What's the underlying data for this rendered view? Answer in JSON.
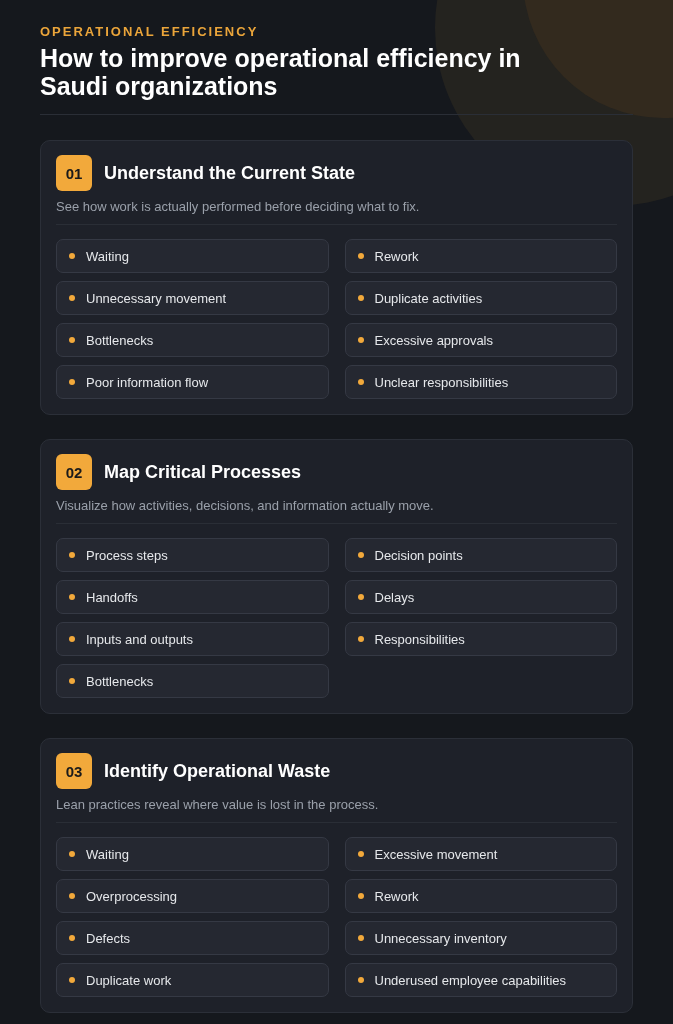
{
  "eyebrow": "OPERATIONAL EFFICIENCY",
  "title": "How to improve operational efficiency in Saudi organizations",
  "sections": [
    {
      "number": "01",
      "title": "Understand the Current State",
      "description": "See how work is actually performed before deciding what to fix.",
      "items": [
        "Waiting",
        "Rework",
        "Unnecessary movement",
        "Duplicate activities",
        "Bottlenecks",
        "Excessive approvals",
        "Poor information flow",
        "Unclear responsibilities"
      ]
    },
    {
      "number": "02",
      "title": "Map Critical Processes",
      "description": "Visualize how activities, decisions, and information actually move.",
      "items": [
        "Process steps",
        "Decision points",
        "Handoffs",
        "Delays",
        "Inputs and outputs",
        "Responsibilities",
        "Bottlenecks"
      ]
    },
    {
      "number": "03",
      "title": "Identify Operational Waste",
      "description": "Lean practices reveal where value is lost in the process.",
      "items": [
        "Waiting",
        "Excessive movement",
        "Overprocessing",
        "Rework",
        "Defects",
        "Unnecessary inventory",
        "Duplicate work",
        "Underused employee capabilities"
      ]
    }
  ]
}
